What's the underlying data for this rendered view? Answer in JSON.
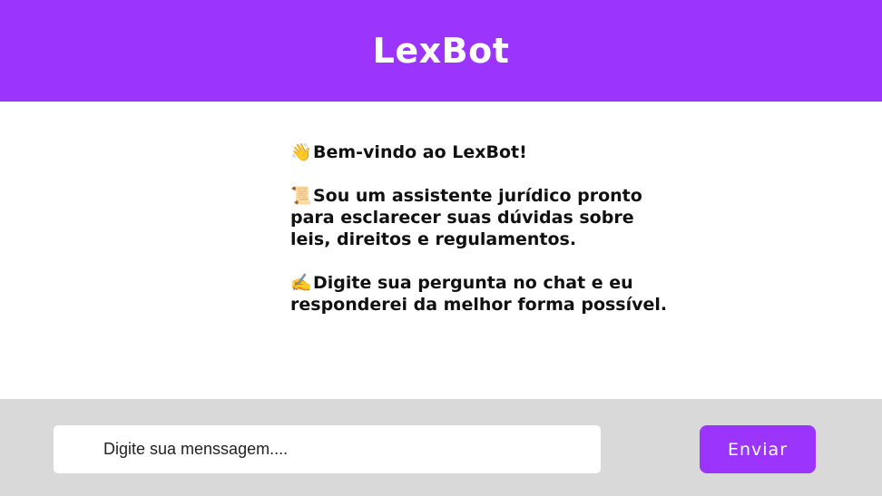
{
  "header": {
    "title": "LexBot"
  },
  "welcome": {
    "greeting_icon": "waving-hand-icon",
    "greeting_emoji": "👋",
    "greeting": "Bem-vindo ao LexBot!",
    "intro_icon": "scroll-icon",
    "intro_emoji": "📜",
    "intro": "Sou um assistente jurídico pronto para esclarecer suas dúvidas sobre leis, direitos e regulamentos.",
    "instruction_icon": "writing-hand-icon",
    "instruction_emoji": "✍️",
    "instruction": "Digite sua pergunta no chat e eu responderei da melhor forma possível."
  },
  "composer": {
    "placeholder": "Digite sua menssagem....",
    "value": "",
    "send_label": "Enviar"
  },
  "colors": {
    "accent": "#9b35fe",
    "footer_bg": "#d9d9d9",
    "background": "#ffffff"
  }
}
